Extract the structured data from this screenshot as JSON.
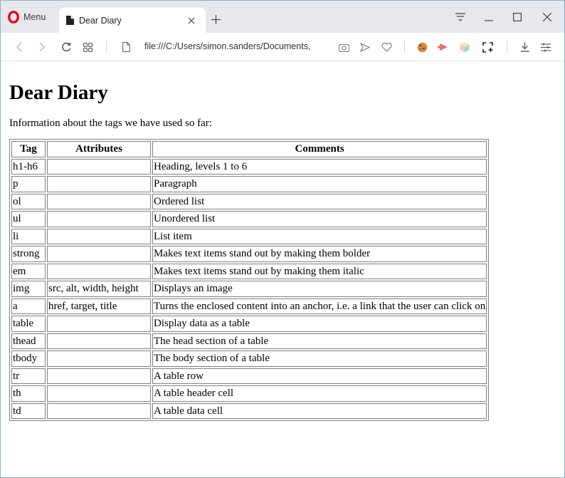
{
  "browser": {
    "menu_label": "Menu",
    "tab_title": "Dear Diary",
    "url": "file:///C:/Users/simon.sanders/Documents,"
  },
  "page": {
    "heading": "Dear Diary",
    "intro": "Information about the tags we have used so far:",
    "table": {
      "headers": [
        "Tag",
        "Attributes",
        "Comments"
      ],
      "rows": [
        [
          "h1-h6",
          "",
          "Heading, levels 1 to 6"
        ],
        [
          "p",
          "",
          "Paragraph"
        ],
        [
          "ol",
          "",
          "Ordered list"
        ],
        [
          "ul",
          "",
          "Unordered list"
        ],
        [
          "li",
          "",
          "List item"
        ],
        [
          "strong",
          "",
          "Makes text items stand out by making them bolder"
        ],
        [
          "em",
          "",
          "Makes text items stand out by making them italic"
        ],
        [
          "img",
          "src, alt, width, height",
          "Displays an image"
        ],
        [
          "a",
          "href, target, title",
          "Turns the enclosed content into an anchor, i.e. a link that the user can click on"
        ],
        [
          "table",
          "",
          "Display data as a table"
        ],
        [
          "thead",
          "",
          "The head section of a table"
        ],
        [
          "tbody",
          "",
          "The body section of a table"
        ],
        [
          "tr",
          "",
          "A table row"
        ],
        [
          "th",
          "",
          "A table header cell"
        ],
        [
          "td",
          "",
          "A table data cell"
        ]
      ]
    }
  },
  "icons": {
    "brand": "opera-logo-icon",
    "accent": "#e3001b"
  }
}
